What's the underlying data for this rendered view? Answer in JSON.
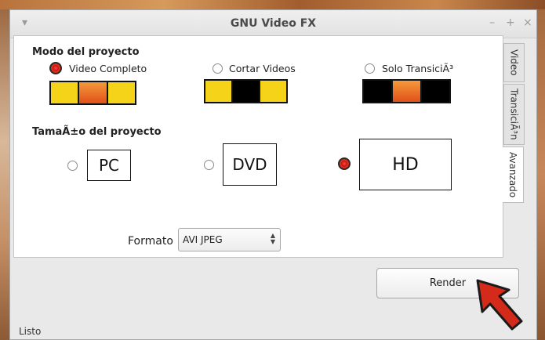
{
  "window": {
    "title": "GNU Video FX",
    "menu_icon": "▾",
    "minimize": "–",
    "maximize": "+",
    "close": "×"
  },
  "tabs": [
    "Video",
    "TransiciÃ³n",
    "Avanzado"
  ],
  "project_mode": {
    "label": "Modo del proyecto",
    "options": [
      {
        "label": "Video Completo",
        "selected": true,
        "strip": [
          "yellow",
          "orange",
          "yellow"
        ]
      },
      {
        "label": "Cortar Videos",
        "selected": false,
        "strip": [
          "yellow",
          "black",
          "yellow"
        ]
      },
      {
        "label": "Solo TransiciÃ³",
        "selected": false,
        "strip": [
          "black",
          "orange",
          "black"
        ]
      }
    ]
  },
  "project_size": {
    "label": "TamaÃ±o del proyecto",
    "options": [
      {
        "label": "PC",
        "selected": false
      },
      {
        "label": "DVD",
        "selected": false
      },
      {
        "label": "HD",
        "selected": true
      }
    ]
  },
  "format": {
    "label": "Formato",
    "value": "AVI JPEG"
  },
  "render_button": "Render",
  "status": "Listo",
  "colors": {
    "accent_red": "#d42a1a",
    "yellow": "#f4d318",
    "orange": "#e0501a"
  }
}
